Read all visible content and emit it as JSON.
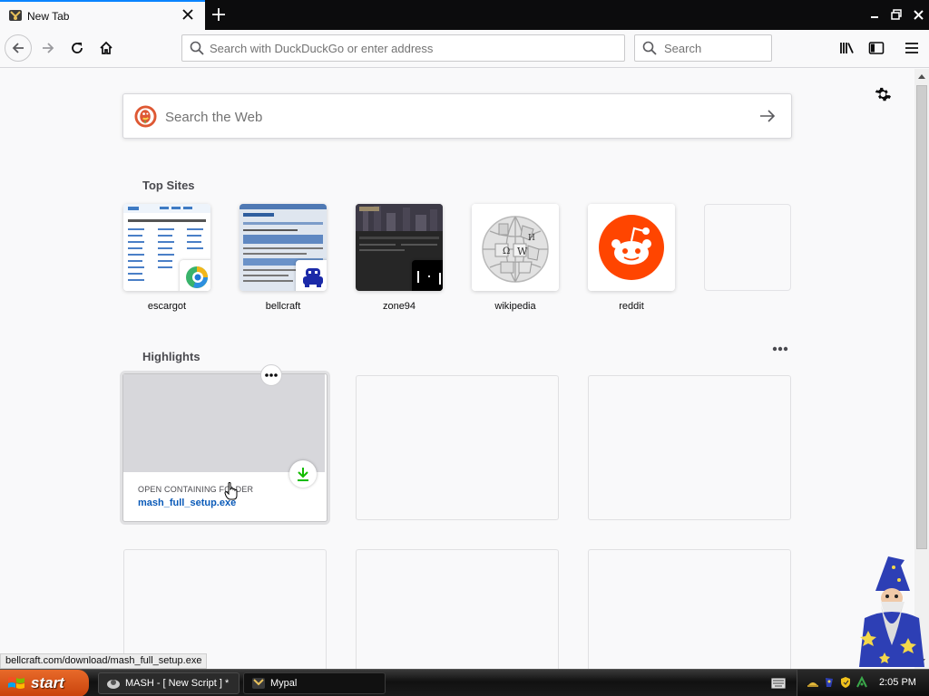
{
  "tab": {
    "title": "New Tab"
  },
  "navbar": {
    "url_placeholder": "Search with DuckDuckGo or enter address",
    "search_placeholder": "Search"
  },
  "page": {
    "search_placeholder": "Search the Web",
    "top_sites_title": "Top Sites",
    "top_sites": [
      {
        "label": "escargot"
      },
      {
        "label": "bellcraft"
      },
      {
        "label": "zone94"
      },
      {
        "label": "wikipedia"
      },
      {
        "label": "reddit"
      },
      {
        "label": ""
      }
    ],
    "highlights_title": "Highlights",
    "highlight": {
      "context_label": "OPEN CONTAINING FOLDER",
      "filename": "mash_full_setup.exe"
    }
  },
  "status": {
    "url": "bellcraft.com/download/mash_full_setup.exe"
  },
  "taskbar": {
    "start_label": "start",
    "tasks": [
      {
        "label": "MASH - [ New Script ] *"
      },
      {
        "label": "Mypal"
      }
    ],
    "clock": "2:05 PM"
  },
  "colors": {
    "accent": "#0a84ff",
    "reddit": "#ff4500",
    "ddg": "#de5833",
    "download": "#12bc00",
    "link": "#0a5ab8"
  }
}
